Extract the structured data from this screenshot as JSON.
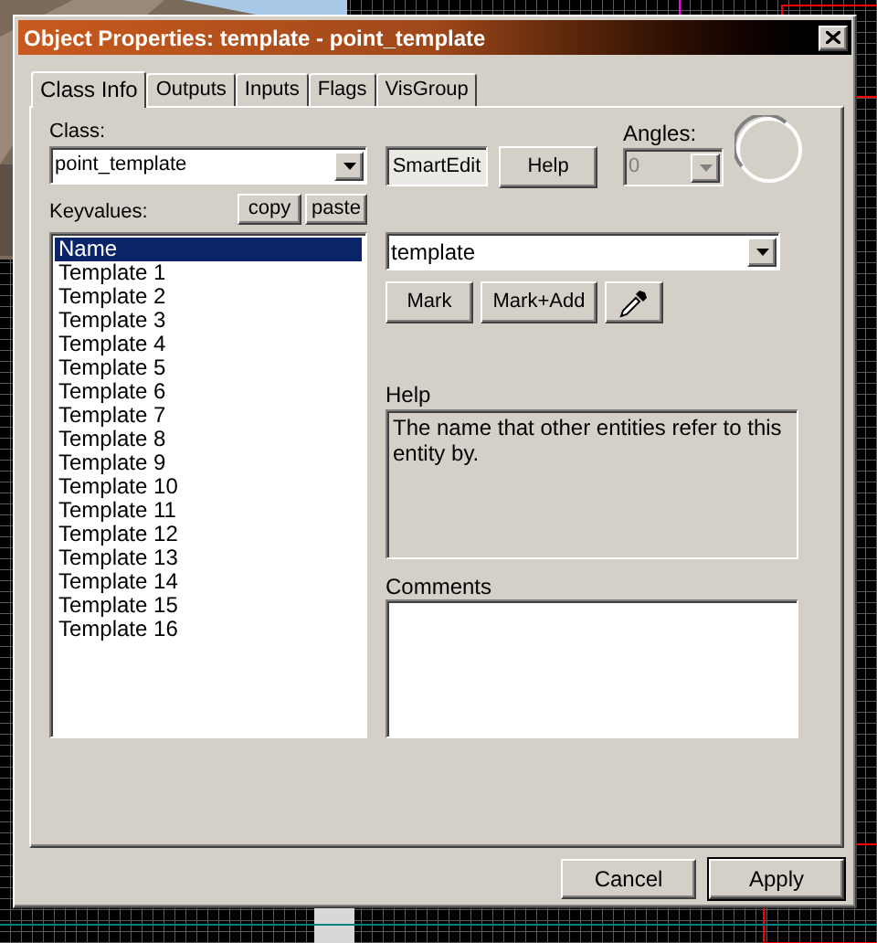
{
  "window": {
    "title": "Object Properties: template - point_template"
  },
  "tabs": [
    {
      "label": "Class Info",
      "selected": true
    },
    {
      "label": "Outputs",
      "selected": false
    },
    {
      "label": "Inputs",
      "selected": false
    },
    {
      "label": "Flags",
      "selected": false
    },
    {
      "label": "VisGroup",
      "selected": false
    }
  ],
  "class_field": {
    "label": "Class:",
    "value": "point_template"
  },
  "smartedit": {
    "label": "SmartEdit",
    "pressed": true
  },
  "help_button": "Help",
  "angles": {
    "label": "Angles:",
    "value": "0",
    "disabled": true
  },
  "keyvalues": {
    "label": "Keyvalues:",
    "copy": "copy",
    "paste": "paste",
    "items": [
      {
        "label": "Name",
        "selected": true
      },
      {
        "label": "Template 1",
        "selected": false
      },
      {
        "label": "Template 2",
        "selected": false
      },
      {
        "label": "Template 3",
        "selected": false
      },
      {
        "label": "Template 4",
        "selected": false
      },
      {
        "label": "Template 5",
        "selected": false
      },
      {
        "label": "Template 6",
        "selected": false
      },
      {
        "label": "Template 7",
        "selected": false
      },
      {
        "label": "Template 8",
        "selected": false
      },
      {
        "label": "Template 9",
        "selected": false
      },
      {
        "label": "Template 10",
        "selected": false
      },
      {
        "label": "Template 11",
        "selected": false
      },
      {
        "label": "Template 12",
        "selected": false
      },
      {
        "label": "Template 13",
        "selected": false
      },
      {
        "label": "Template 14",
        "selected": false
      },
      {
        "label": "Template 15",
        "selected": false
      },
      {
        "label": "Template 16",
        "selected": false
      }
    ]
  },
  "value_field": {
    "value": "template"
  },
  "mark_buttons": [
    "Mark",
    "Mark+Add"
  ],
  "help": {
    "label": "Help",
    "text": "The name that other entities refer to this entity by."
  },
  "comments": {
    "label": "Comments"
  },
  "footer_buttons": [
    {
      "label": "Cancel",
      "default": false
    },
    {
      "label": "Apply",
      "default": true
    }
  ]
}
